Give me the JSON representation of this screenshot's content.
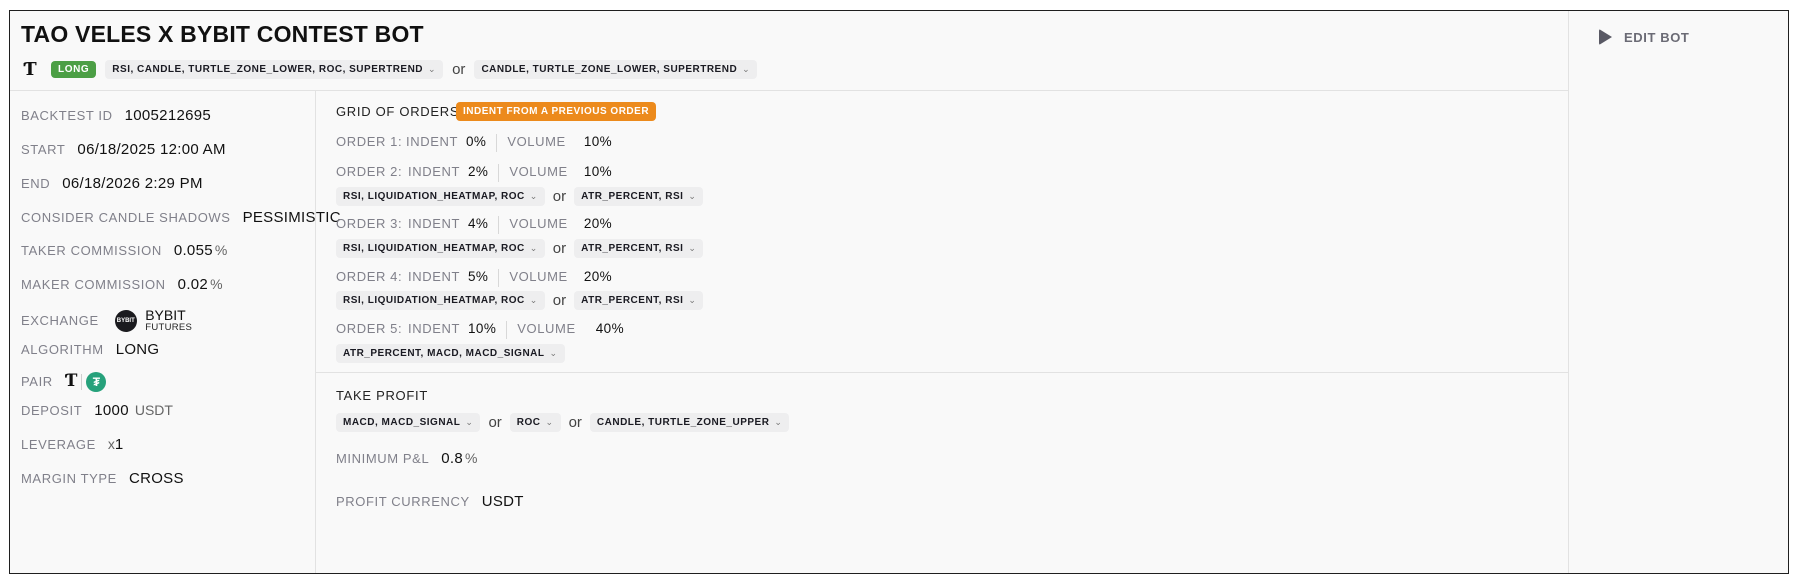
{
  "header": {
    "title": "TAO VELES X BYBIT CONTEST BOT",
    "logo_glyph": "Ƭ",
    "side_badge": "LONG",
    "entry_conditions": [
      "RSI, CANDLE, TURTLE_ZONE_LOWER, ROC, SUPERTREND",
      "CANDLE, TURTLE_ZONE_LOWER, SUPERTREND"
    ],
    "or_label": "or"
  },
  "actions": {
    "edit_label": "EDIT BOT"
  },
  "details": {
    "backtest_id": {
      "label": "BACKTEST ID",
      "value": "1005212695"
    },
    "start": {
      "label": "START",
      "value": "06/18/2025 12:00 AM"
    },
    "end": {
      "label": "END",
      "value": "06/18/2026 2:29 PM"
    },
    "candle_shadows": {
      "label": "CONSIDER CANDLE SHADOWS",
      "value": "PESSIMISTIC"
    },
    "taker_commission": {
      "label": "TAKER COMMISSION",
      "value": "0.055",
      "unit": "%"
    },
    "maker_commission": {
      "label": "MAKER COMMISSION",
      "value": "0.02",
      "unit": "%"
    },
    "exchange": {
      "label": "EXCHANGE",
      "logo_text": "BYBIT",
      "name": "BYBIT",
      "type": "FUTURES"
    },
    "algorithm": {
      "label": "ALGORITHM",
      "value": "LONG"
    },
    "pair": {
      "label": "PAIR",
      "base_glyph": "Ƭ",
      "quote_glyph": "₮"
    },
    "deposit": {
      "label": "DEPOSIT",
      "value": "1000",
      "unit": "USDT"
    },
    "leverage": {
      "label": "LEVERAGE",
      "prefix": "x",
      "value": "1"
    },
    "margin_type": {
      "label": "MARGIN TYPE",
      "value": "CROSS"
    }
  },
  "grid": {
    "title": "GRID OF ORDERS",
    "badge": "INDENT FROM A PREVIOUS ORDER",
    "indent_label": "INDENT",
    "volume_label": "VOLUME",
    "unit": "%",
    "orders": [
      {
        "label": "ORDER 1:",
        "indent": "0",
        "volume": "10",
        "conditions": []
      },
      {
        "label": "ORDER 2:",
        "indent": "2",
        "volume": "10",
        "conditions": [
          "RSI, LIQUIDATION_HEATMAP, ROC",
          "ATR_PERCENT, RSI"
        ]
      },
      {
        "label": "ORDER 3:",
        "indent": "4",
        "volume": "20",
        "conditions": [
          "RSI, LIQUIDATION_HEATMAP, ROC",
          "ATR_PERCENT, RSI"
        ]
      },
      {
        "label": "ORDER 4:",
        "indent": "5",
        "volume": "20",
        "conditions": [
          "RSI, LIQUIDATION_HEATMAP, ROC",
          "ATR_PERCENT, RSI"
        ]
      },
      {
        "label": "ORDER 5:",
        "indent": "10",
        "volume": "40",
        "conditions": [
          "ATR_PERCENT, MACD, MACD_SIGNAL"
        ]
      }
    ]
  },
  "take_profit": {
    "title": "TAKE PROFIT",
    "conditions": [
      "MACD, MACD_SIGNAL",
      "ROC",
      "CANDLE, TURTLE_ZONE_UPPER"
    ],
    "min_pnl": {
      "label": "MINIMUM P&L",
      "value": "0.8",
      "unit": "%"
    },
    "profit_currency": {
      "label": "PROFIT CURRENCY",
      "value": "USDT"
    }
  },
  "icons": {
    "chevron": "⌄",
    "edit": "play-icon"
  }
}
